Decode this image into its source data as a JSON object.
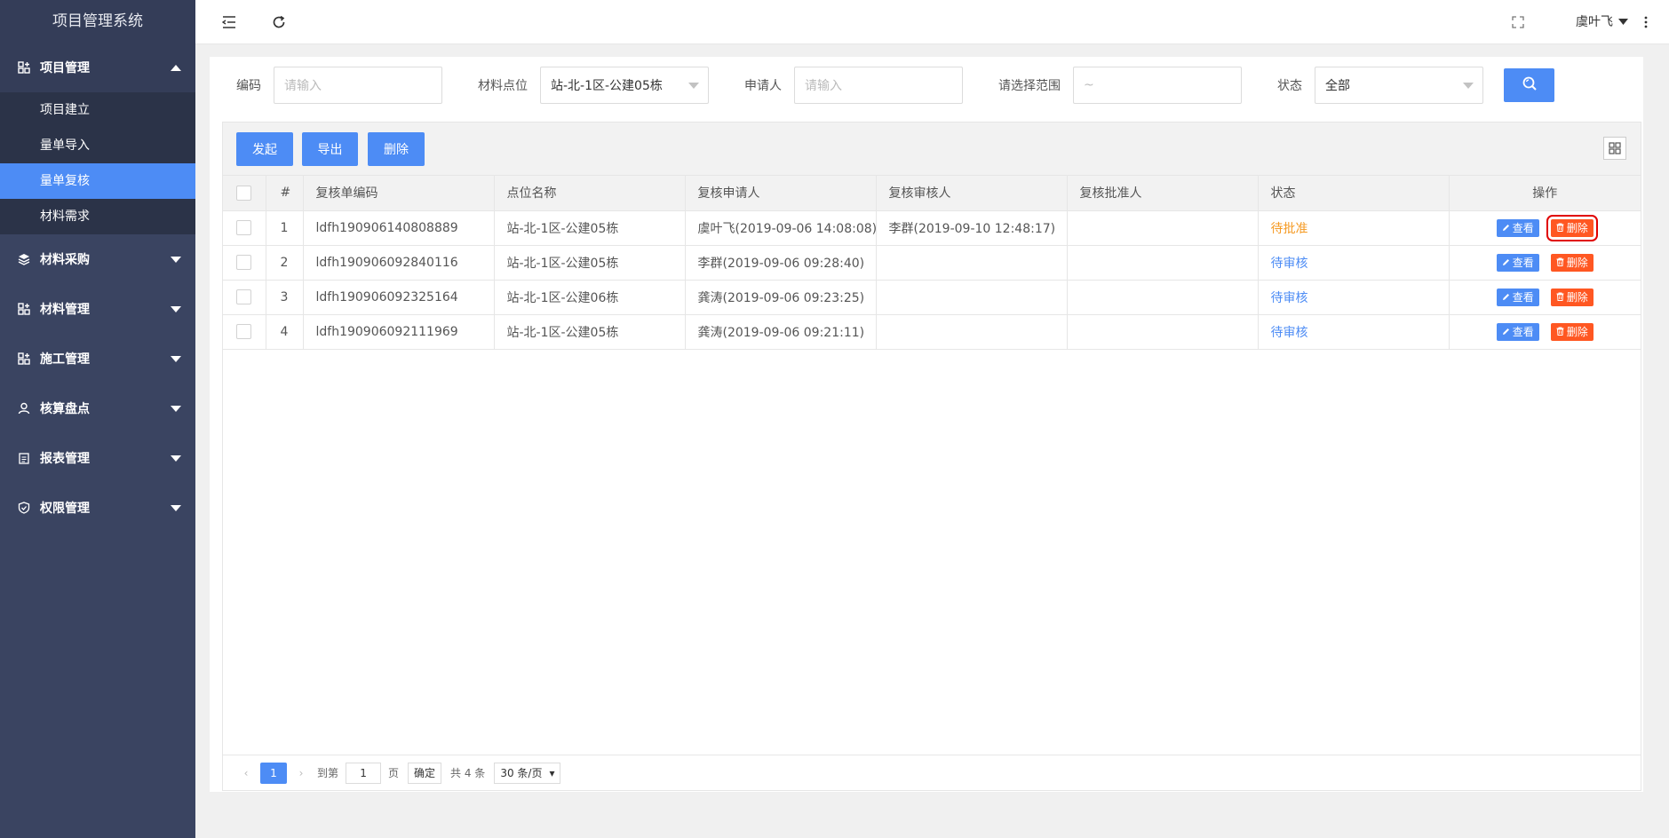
{
  "app": {
    "title": "项目管理系统"
  },
  "sidebar": {
    "groups": [
      {
        "label": "项目管理",
        "icon": "grid-icon",
        "expanded": true,
        "items": [
          {
            "label": "项目建立"
          },
          {
            "label": "量单导入"
          },
          {
            "label": "量单复核",
            "active": true
          },
          {
            "label": "材料需求"
          }
        ]
      },
      {
        "label": "材料采购",
        "icon": "layers-icon"
      },
      {
        "label": "材料管理",
        "icon": "grid-icon"
      },
      {
        "label": "施工管理",
        "icon": "grid-icon"
      },
      {
        "label": "核算盘点",
        "icon": "user-icon"
      },
      {
        "label": "报表管理",
        "icon": "clipboard-icon"
      },
      {
        "label": "权限管理",
        "icon": "shield-icon"
      }
    ]
  },
  "header": {
    "user": "虞叶飞"
  },
  "filters": {
    "code_label": "编码",
    "code_placeholder": "请输入",
    "location_label": "材料点位",
    "location_value": "站-北-1区-公建05栋",
    "applicant_label": "申请人",
    "applicant_placeholder": "请输入",
    "range_label": "请选择范围",
    "range_placeholder": "~",
    "status_label": "状态",
    "status_value": "全部"
  },
  "toolbar": {
    "start": "发起",
    "export": "导出",
    "delete": "删除"
  },
  "table": {
    "headers": [
      "#",
      "复核单编码",
      "点位名称",
      "复核申请人",
      "复核审核人",
      "复核批准人",
      "状态",
      "操作"
    ],
    "rows": [
      {
        "no": "1",
        "code": "ldfh190906140808889",
        "location": "站-北-1区-公建05栋",
        "applicant": "虞叶飞(2019-09-06 14:08:08)",
        "reviewer": "李群(2019-09-10 12:48:17)",
        "approver": "",
        "status": "待批准"
      },
      {
        "no": "2",
        "code": "ldfh190906092840116",
        "location": "站-北-1区-公建05栋",
        "applicant": "李群(2019-09-06 09:28:40)",
        "reviewer": "",
        "approver": "",
        "status": "待审核"
      },
      {
        "no": "3",
        "code": "ldfh190906092325164",
        "location": "站-北-1区-公建06栋",
        "applicant": "龚涛(2019-09-06 09:23:25)",
        "reviewer": "",
        "approver": "",
        "status": "待审核"
      },
      {
        "no": "4",
        "code": "ldfh190906092111969",
        "location": "站-北-1区-公建05栋",
        "applicant": "龚涛(2019-09-06 09:21:11)",
        "reviewer": "",
        "approver": "",
        "status": "待审核"
      }
    ],
    "view_label": "查看",
    "delete_label": "删除"
  },
  "pager": {
    "current": "1",
    "goto_prefix": "到第",
    "goto_value": "1",
    "goto_suffix": "页",
    "confirm": "确定",
    "total": "共 4 条",
    "page_size": "30 条/页"
  }
}
